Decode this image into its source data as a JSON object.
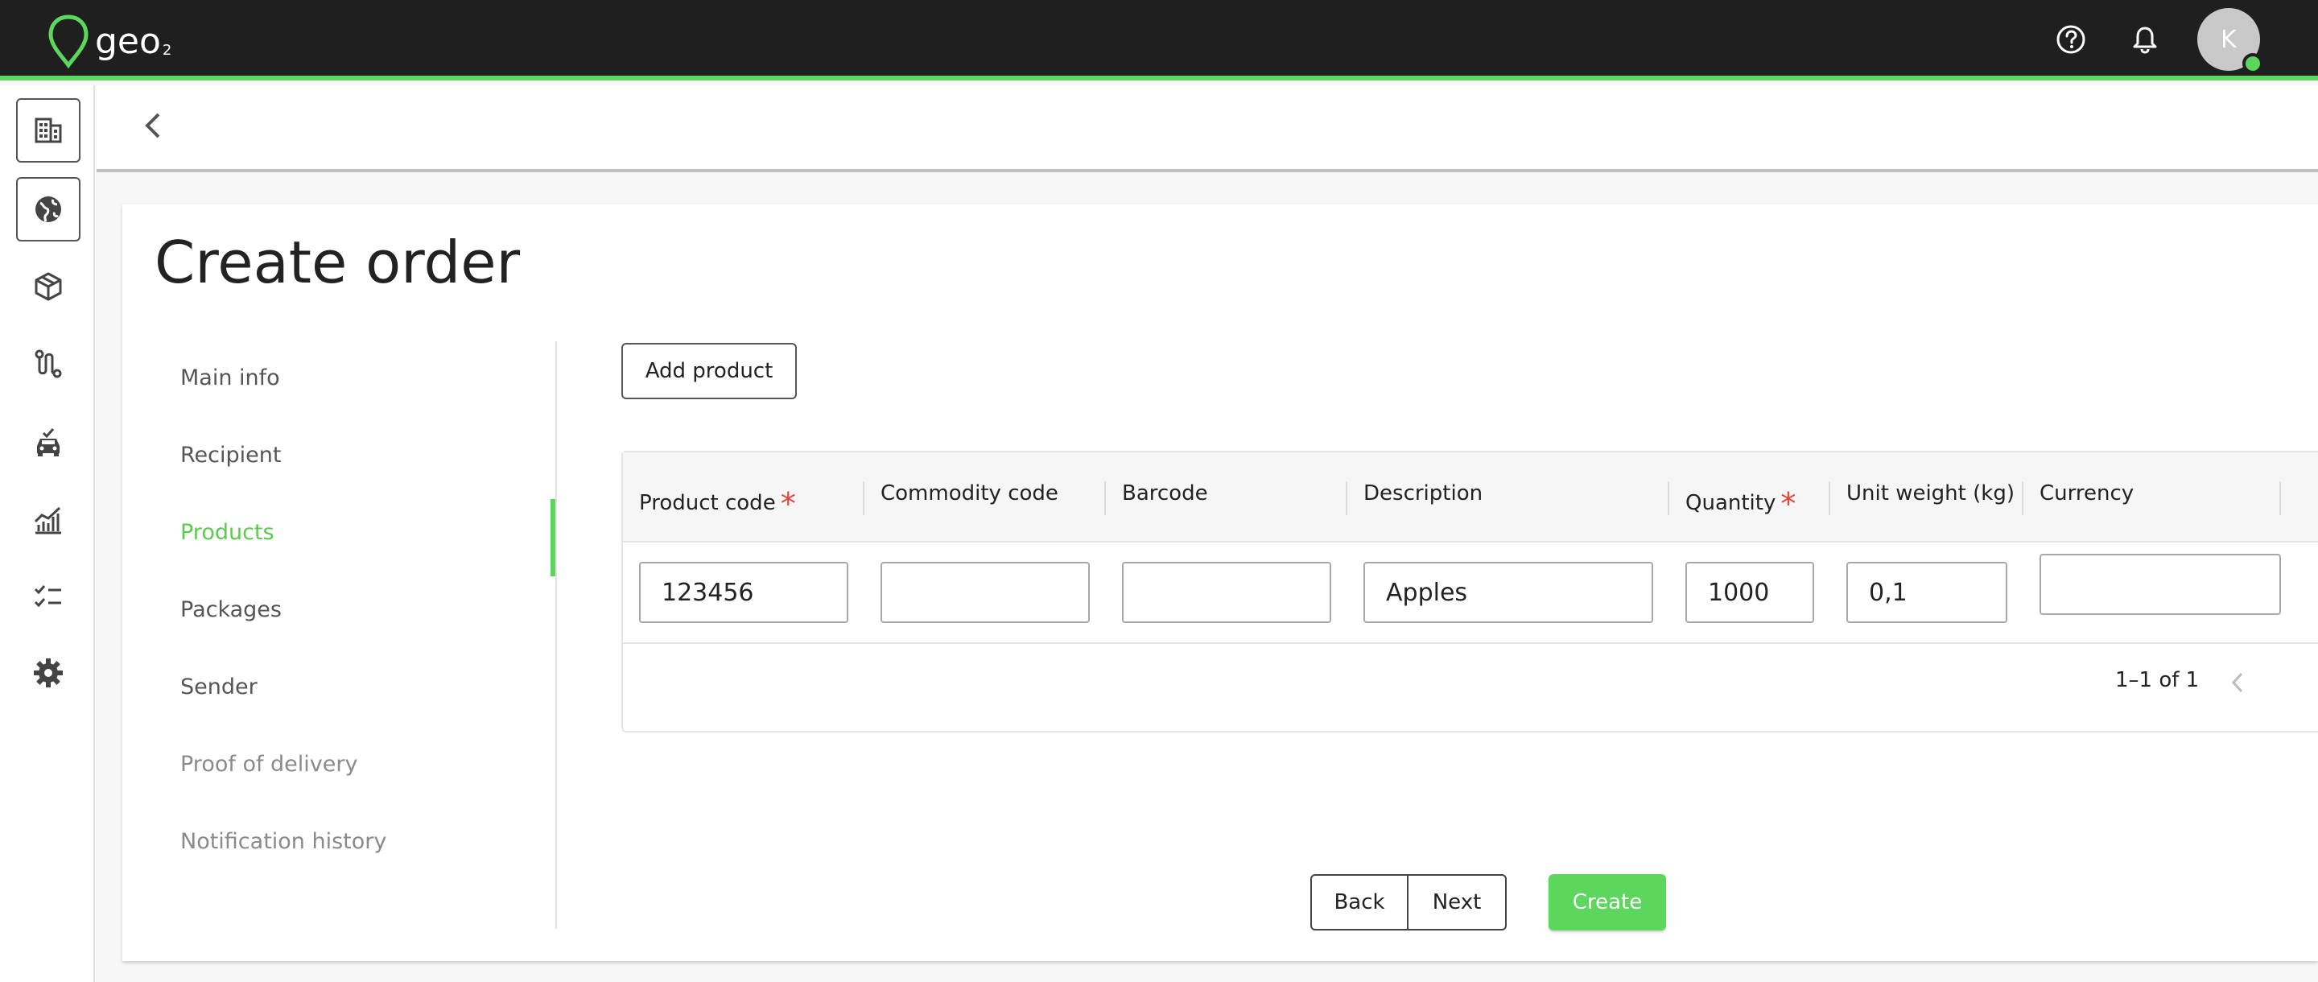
{
  "topbar": {
    "logo_text": "geo",
    "logo_sub": "2",
    "help_icon": "help-circle-icon",
    "notifications_icon": "bell-icon",
    "avatar_initial": "K",
    "accent_color": "#5cd65c"
  },
  "rail": {
    "items": [
      {
        "icon": "building-icon"
      },
      {
        "icon": "globe-icon"
      },
      {
        "icon": "package-icon"
      },
      {
        "icon": "route-icon"
      },
      {
        "icon": "vehicle-check-icon"
      },
      {
        "icon": "analytics-icon"
      },
      {
        "icon": "checklist-icon"
      },
      {
        "icon": "gear-icon"
      }
    ]
  },
  "page": {
    "title": "Create order",
    "back_icon": "chevron-left-icon"
  },
  "steps": [
    {
      "label": "Main info",
      "state": "default"
    },
    {
      "label": "Recipient",
      "state": "default"
    },
    {
      "label": "Products",
      "state": "active"
    },
    {
      "label": "Packages",
      "state": "default"
    },
    {
      "label": "Sender",
      "state": "default"
    },
    {
      "label": "Proof of delivery",
      "state": "muted"
    },
    {
      "label": "Notification history",
      "state": "muted"
    }
  ],
  "products": {
    "add_button": "Add product",
    "required_mark": "*",
    "columns": [
      "Product code",
      "Commodity code",
      "Barcode",
      "Description",
      "Quantity",
      "Unit weight (kg)",
      "Currency"
    ],
    "rows": [
      {
        "product_code": "123456",
        "commodity_code": "",
        "barcode": "",
        "description": "Apples",
        "quantity": "1000",
        "unit_weight": "0,1",
        "currency": ""
      }
    ],
    "pagination": "1–1 of 1"
  },
  "actions": {
    "back": "Back",
    "next": "Next",
    "create": "Create"
  }
}
